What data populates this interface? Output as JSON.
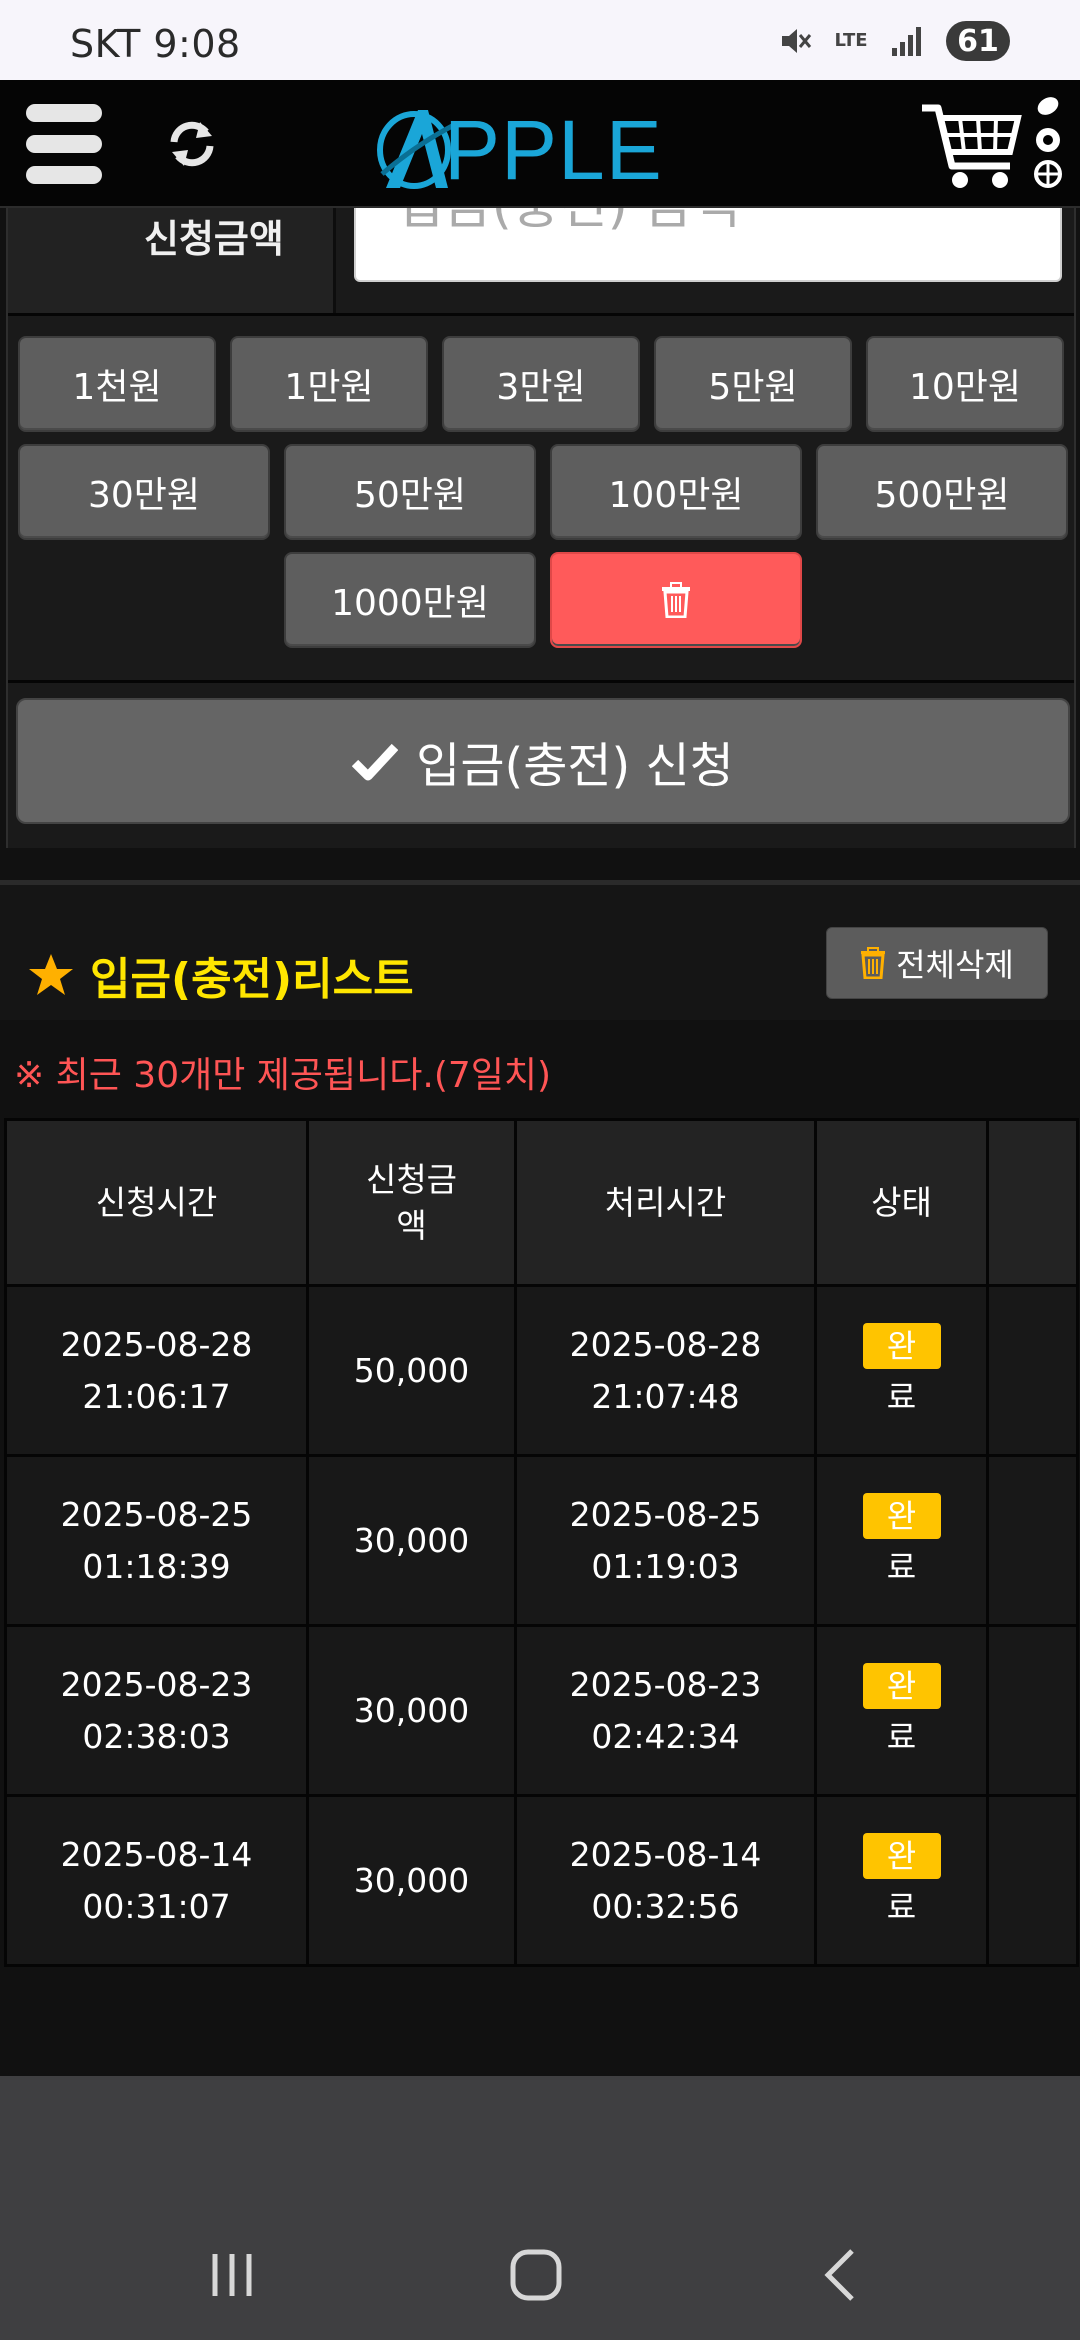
{
  "status_bar": {
    "carrier_time": "SKT 9:08",
    "network": "LTE",
    "battery": "61"
  },
  "header": {
    "logo_text": "PPLE",
    "icons": [
      "menu-icon",
      "refresh-icon",
      "cart-icon",
      "sports-balls-icon"
    ]
  },
  "form": {
    "amount_label": "신청금액",
    "amount_placeholder": "입금(충전) 금액",
    "quick_amounts_row1": [
      "1천원",
      "1만원",
      "3만원",
      "5만원",
      "10만원"
    ],
    "quick_amounts_row2": [
      "30만원",
      "50만원",
      "100만원",
      "500만원"
    ],
    "quick_amounts_row3": [
      "1000만원"
    ],
    "clear_icon": "trash-icon",
    "submit_label": "입금(충전) 신청"
  },
  "list": {
    "title": "입금(충전)리스트",
    "delete_all_label": "전체삭제",
    "notice": "※ 최근 30개만 제공됩니다.(7일치)",
    "columns": [
      "신청시간",
      "신청금액",
      "처리시간",
      "상태",
      ""
    ],
    "rows": [
      {
        "req_date": "2025-08-28",
        "req_time": "21:06:17",
        "amount": "50,000",
        "proc_date": "2025-08-28",
        "proc_time": "21:07:48",
        "status_1": "완",
        "status_2": "료"
      },
      {
        "req_date": "2025-08-25",
        "req_time": "01:18:39",
        "amount": "30,000",
        "proc_date": "2025-08-25",
        "proc_time": "01:19:03",
        "status_1": "완",
        "status_2": "료"
      },
      {
        "req_date": "2025-08-23",
        "req_time": "02:38:03",
        "amount": "30,000",
        "proc_date": "2025-08-23",
        "proc_time": "02:42:34",
        "status_1": "완",
        "status_2": "료"
      },
      {
        "req_date": "2025-08-14",
        "req_time": "00:31:07",
        "amount": "30,000",
        "proc_date": "2025-08-14",
        "proc_time": "00:32:56",
        "status_1": "완",
        "status_2": "료"
      }
    ]
  },
  "colors": {
    "accent_yellow": "#ffe600",
    "status_badge": "#ffc400",
    "notice_red": "#ff5555",
    "clear_button": "#ff5a5a",
    "logo_blue": "#1aa6d8"
  }
}
